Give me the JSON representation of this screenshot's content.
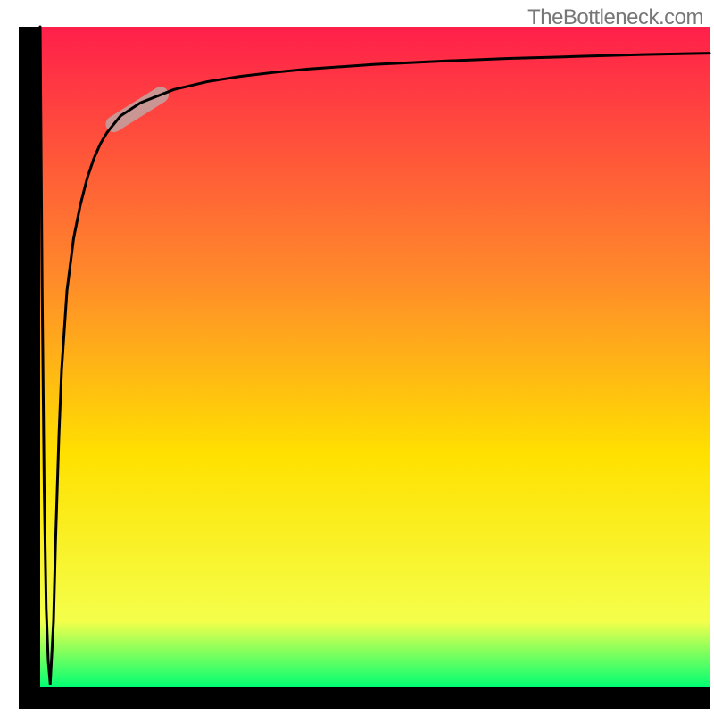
{
  "watermark": "TheBottleneck.com",
  "colors": {
    "axis": "#000000",
    "curve": "#000000",
    "highlight": "#c99693",
    "gradient_top": "#ff1f4a",
    "gradient_upper_mid": "#ff8a2a",
    "gradient_mid": "#ffe100",
    "gradient_lower_mid": "#f4ff4a",
    "gradient_bottom": "#00ff73"
  },
  "chart_data": {
    "type": "line",
    "title": "",
    "xlabel": "",
    "ylabel": "",
    "xlim": [
      0,
      100
    ],
    "ylim": [
      0,
      100
    ],
    "legend": false,
    "grid": false,
    "annotations": [
      {
        "kind": "highlight-segment",
        "x_start": 11,
        "x_end": 18,
        "note": "rounded capsule on curve"
      }
    ],
    "series": [
      {
        "name": "bottleneck-curve",
        "x": [
          0.0,
          0.3,
          0.6,
          0.9,
          1.2,
          1.5,
          2.0,
          2.3,
          2.8,
          3.2,
          4.0,
          5.0,
          6.0,
          7.0,
          8.0,
          9.0,
          10.0,
          12.0,
          15.0,
          20.0,
          25.0,
          30.0,
          35.0,
          40.0,
          50.0,
          60.0,
          70.0,
          80.0,
          90.0,
          100.0
        ],
        "y": [
          100.0,
          60.0,
          30.0,
          12.0,
          4.0,
          0.5,
          10.0,
          22.0,
          38.0,
          48.0,
          60.0,
          68.0,
          73.0,
          77.0,
          80.0,
          82.3,
          84.0,
          86.5,
          88.5,
          90.5,
          91.7,
          92.5,
          93.1,
          93.6,
          94.3,
          94.8,
          95.2,
          95.5,
          95.8,
          96.0
        ]
      }
    ]
  }
}
